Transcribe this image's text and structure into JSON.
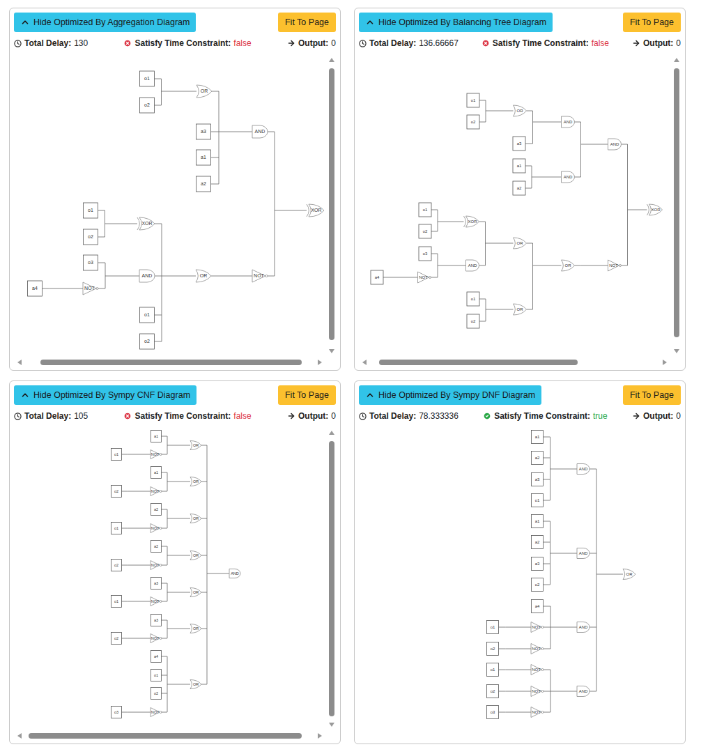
{
  "panels": [
    {
      "toggle_button": "Hide Optimized By Aggregation Diagram",
      "fit_button": "Fit To Page",
      "delay_label": "Total Delay:",
      "delay": "130",
      "constraint_label": "Satisfy Time Constraint:",
      "constraint_value": "false",
      "satisfied": false,
      "output_label": "Output:",
      "output": "0",
      "scroll": {
        "horizontal": [
          0.05,
          0.96
        ],
        "vertical": [
          0.01,
          0.98
        ]
      },
      "nodes": [
        {
          "label": "o1",
          "kind": "input"
        },
        {
          "label": "o2",
          "kind": "input"
        },
        {
          "label": "OR",
          "kind": "or"
        },
        {
          "label": "a3",
          "kind": "input"
        },
        {
          "label": "a1",
          "kind": "input"
        },
        {
          "label": "a2",
          "kind": "input"
        },
        {
          "label": "AND",
          "kind": "and"
        },
        {
          "label": "o1",
          "kind": "input"
        },
        {
          "label": "o2",
          "kind": "input"
        },
        {
          "label": "XOR",
          "kind": "xor"
        },
        {
          "label": "o3",
          "kind": "input"
        },
        {
          "label": "a4",
          "kind": "input"
        },
        {
          "label": "NOT",
          "kind": "not"
        },
        {
          "label": "AND",
          "kind": "and"
        },
        {
          "label": "o1",
          "kind": "input"
        },
        {
          "label": "o2",
          "kind": "input"
        },
        {
          "label": "OR",
          "kind": "or"
        },
        {
          "label": "NOT",
          "kind": "not"
        },
        {
          "label": "XOR",
          "kind": "xor"
        }
      ]
    },
    {
      "toggle_button": "Hide Optimized By Balancing Tree Diagram",
      "fit_button": "Fit To Page",
      "delay_label": "Total Delay:",
      "delay": "136.66667",
      "constraint_label": "Satisfy Time Constraint:",
      "constraint_value": "false",
      "satisfied": false,
      "output_label": "Output:",
      "output": "0",
      "scroll": {
        "horizontal": [
          0.03,
          0.72
        ],
        "vertical": [
          0.01,
          0.97
        ]
      },
      "nodes": [
        {
          "label": "o1",
          "kind": "input"
        },
        {
          "label": "o2",
          "kind": "input"
        },
        {
          "label": "OR",
          "kind": "or"
        },
        {
          "label": "a3",
          "kind": "input"
        },
        {
          "label": "AND",
          "kind": "and"
        },
        {
          "label": "a1",
          "kind": "input"
        },
        {
          "label": "a2",
          "kind": "input"
        },
        {
          "label": "AND",
          "kind": "and"
        },
        {
          "label": "AND",
          "kind": "and"
        },
        {
          "label": "o1",
          "kind": "input"
        },
        {
          "label": "o2",
          "kind": "input"
        },
        {
          "label": "XOR",
          "kind": "xor"
        },
        {
          "label": "o3",
          "kind": "input"
        },
        {
          "label": "a4",
          "kind": "input"
        },
        {
          "label": "NOT",
          "kind": "not"
        },
        {
          "label": "AND",
          "kind": "and"
        },
        {
          "label": "OR",
          "kind": "or"
        },
        {
          "label": "o1",
          "kind": "input"
        },
        {
          "label": "o2",
          "kind": "input"
        },
        {
          "label": "OR",
          "kind": "or"
        },
        {
          "label": "OR",
          "kind": "or"
        },
        {
          "label": "NOT",
          "kind": "not"
        },
        {
          "label": "XOR",
          "kind": "xor"
        }
      ]
    },
    {
      "toggle_button": "Hide Optimized By Sympy CNF Diagram",
      "fit_button": "Fit To Page",
      "delay_label": "Total Delay:",
      "delay": "105",
      "constraint_label": "Satisfy Time Constraint:",
      "constraint_value": "false",
      "satisfied": false,
      "output_label": "Output:",
      "output": "0",
      "scroll": {
        "horizontal": [
          0.01,
          0.96
        ],
        "vertical": [
          0.01,
          0.99
        ]
      },
      "nodes": [
        {
          "label": "a1",
          "kind": "input"
        },
        {
          "label": "o1",
          "kind": "input"
        },
        {
          "label": "NOT",
          "kind": "not"
        },
        {
          "label": "OR",
          "kind": "or"
        },
        {
          "label": "a1",
          "kind": "input"
        },
        {
          "label": "o2",
          "kind": "input"
        },
        {
          "label": "NOT",
          "kind": "not"
        },
        {
          "label": "OR",
          "kind": "or"
        },
        {
          "label": "a2",
          "kind": "input"
        },
        {
          "label": "o1",
          "kind": "input"
        },
        {
          "label": "NOT",
          "kind": "not"
        },
        {
          "label": "OR",
          "kind": "or"
        },
        {
          "label": "a2",
          "kind": "input"
        },
        {
          "label": "o2",
          "kind": "input"
        },
        {
          "label": "NOT",
          "kind": "not"
        },
        {
          "label": "OR",
          "kind": "or"
        },
        {
          "label": "a3",
          "kind": "input"
        },
        {
          "label": "o1",
          "kind": "input"
        },
        {
          "label": "NOT",
          "kind": "not"
        },
        {
          "label": "OR",
          "kind": "or"
        },
        {
          "label": "a3",
          "kind": "input"
        },
        {
          "label": "o2",
          "kind": "input"
        },
        {
          "label": "NOT",
          "kind": "not"
        },
        {
          "label": "OR",
          "kind": "or"
        },
        {
          "label": "a4",
          "kind": "input"
        },
        {
          "label": "o1",
          "kind": "input"
        },
        {
          "label": "o2",
          "kind": "input"
        },
        {
          "label": "o3",
          "kind": "input"
        },
        {
          "label": "NOT",
          "kind": "not"
        },
        {
          "label": "OR",
          "kind": "or"
        },
        {
          "label": "AND",
          "kind": "and"
        }
      ]
    },
    {
      "toggle_button": "Hide Optimized By Sympy DNF Diagram",
      "fit_button": "Fit To Page",
      "delay_label": "Total Delay:",
      "delay": "78.333336",
      "constraint_label": "Satisfy Time Constraint:",
      "constraint_value": "true",
      "satisfied": true,
      "output_label": "Output:",
      "output": "0",
      "scroll": null,
      "nodes": [
        {
          "label": "a1",
          "kind": "input"
        },
        {
          "label": "a2",
          "kind": "input"
        },
        {
          "label": "a3",
          "kind": "input"
        },
        {
          "label": "o1",
          "kind": "input"
        },
        {
          "label": "AND",
          "kind": "and"
        },
        {
          "label": "a1",
          "kind": "input"
        },
        {
          "label": "a2",
          "kind": "input"
        },
        {
          "label": "a3",
          "kind": "input"
        },
        {
          "label": "o2",
          "kind": "input"
        },
        {
          "label": "AND",
          "kind": "and"
        },
        {
          "label": "a4",
          "kind": "input"
        },
        {
          "label": "o1",
          "kind": "input"
        },
        {
          "label": "NOT",
          "kind": "not"
        },
        {
          "label": "o2",
          "kind": "input"
        },
        {
          "label": "NOT",
          "kind": "not"
        },
        {
          "label": "AND",
          "kind": "and"
        },
        {
          "label": "o1",
          "kind": "input"
        },
        {
          "label": "NOT",
          "kind": "not"
        },
        {
          "label": "o2",
          "kind": "input"
        },
        {
          "label": "NOT",
          "kind": "not"
        },
        {
          "label": "o3",
          "kind": "input"
        },
        {
          "label": "NOT",
          "kind": "not"
        },
        {
          "label": "AND",
          "kind": "and"
        },
        {
          "label": "OR",
          "kind": "or"
        }
      ]
    }
  ]
}
